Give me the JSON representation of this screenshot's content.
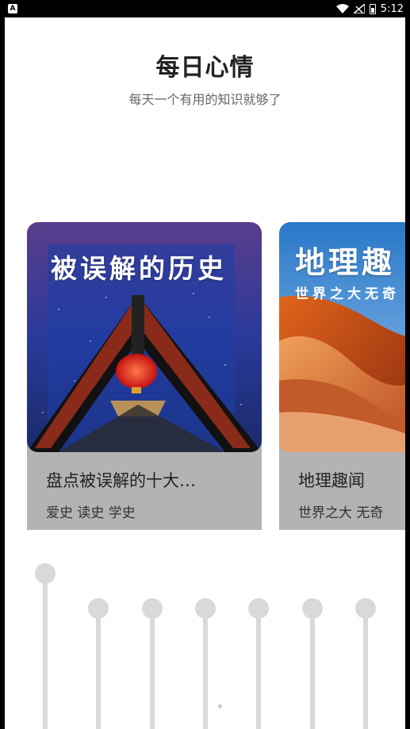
{
  "status_bar": {
    "left_icon_label": "A",
    "time": "5:12",
    "icons": [
      "wifi-icon",
      "signal-icon",
      "battery-icon"
    ]
  },
  "header": {
    "title": "每日心情",
    "subtitle": "每天一个有用的知识就够了"
  },
  "cards": [
    {
      "image_title": "被误解的历史",
      "title": "盘点被误解的十大…",
      "tags": "爱史  读史  学史"
    },
    {
      "image_title": "地理趣",
      "image_subtitle": "世界之大无奇",
      "title": "地理趣闻",
      "tags": "世界之大  无奇"
    }
  ],
  "sliders": {
    "count": 7,
    "selected_index": 0
  },
  "colors": {
    "card_background": "#b3b3b3",
    "slider": "#d9d9d9",
    "title_text": "#222222",
    "subtitle_text": "#666666"
  }
}
